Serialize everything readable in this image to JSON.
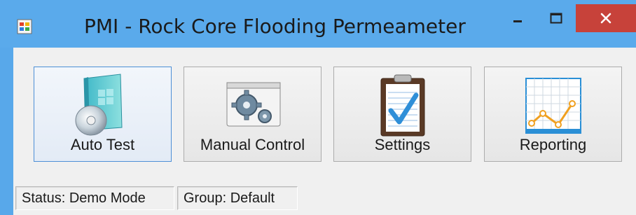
{
  "window": {
    "title": "PMI - Rock Core Flooding Permeameter",
    "controls": {
      "minimize_icon": "minimize-icon",
      "maximize_icon": "maximize-icon",
      "close_icon": "close-icon"
    }
  },
  "tiles": [
    {
      "label": "Auto Test",
      "icon": "auto-test-disc-icon",
      "focused": true
    },
    {
      "label": "Manual Control",
      "icon": "gears-icon",
      "focused": false
    },
    {
      "label": "Settings",
      "icon": "clipboard-check-icon",
      "focused": false
    },
    {
      "label": "Reporting",
      "icon": "line-chart-icon",
      "focused": false
    }
  ],
  "statusbar": {
    "status": "Status: Demo Mode",
    "group": "Group: Default"
  },
  "colors": {
    "title_bar": "#5aaaeb",
    "close_button": "#c7423a",
    "client_bg": "#f0f0f0",
    "focus_border": "#4d8fd6"
  }
}
